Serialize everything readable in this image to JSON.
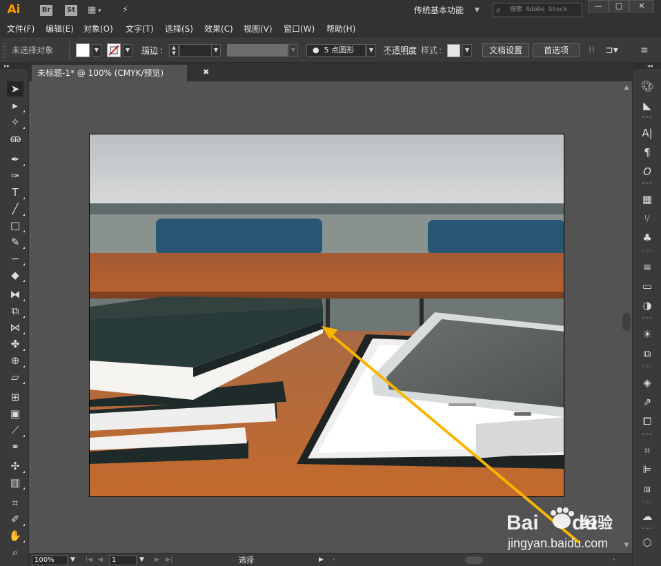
{
  "app": {
    "logo": "Ai",
    "bridge_label": "Br",
    "stock_label": "St",
    "workspace": "传统基本功能",
    "search_placeholder": "搜索 Adobe Stock"
  },
  "menu": [
    "文件(F)",
    "编辑(E)",
    "对象(O)",
    "文字(T)",
    "选择(S)",
    "效果(C)",
    "视图(V)",
    "窗口(W)",
    "帮助(H)"
  ],
  "control_bar": {
    "selection_status": "未选择对象",
    "stroke_label": "描边",
    "brush_value": "5 点圆形",
    "opacity_label": "不透明度",
    "style_label": "样式",
    "doc_setup_button": "文档设置",
    "preferences_button": "首选项"
  },
  "document": {
    "tab_title": "未标题-1* @ 100% (CMYK/预览)"
  },
  "status_bar": {
    "zoom": "100%",
    "page": "1",
    "tool_status": "选择"
  },
  "watermark": {
    "brand": "Bai",
    "brand_suffix": "du",
    "jingyan": "经验",
    "url": "jingyan.baidu.com"
  },
  "colors": {
    "accent": "#ff9a00",
    "annotation_arrow": "#f7b500",
    "ui_dark": "#323232",
    "ui_panel": "#3a3a3a",
    "canvas_bg": "#535353"
  },
  "artboard_image": "photo of stacked hardcover books and a tablet on a wooden desk with blue chairs"
}
